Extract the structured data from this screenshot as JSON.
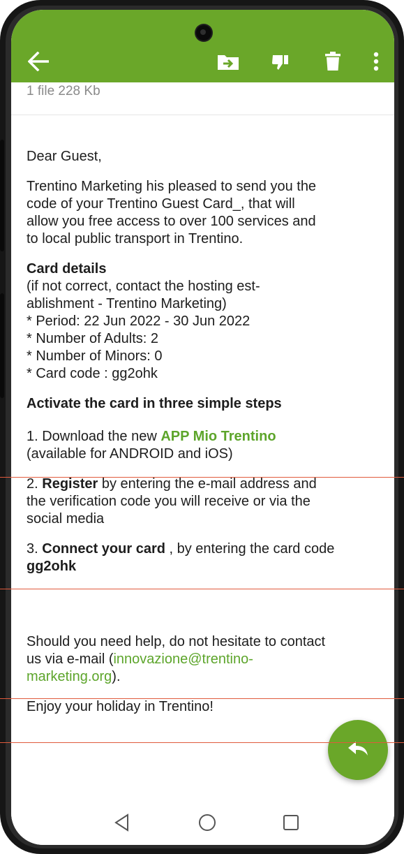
{
  "colors": {
    "accent": "#6aa729",
    "link": "#5da52b",
    "annotation_line": "#e05a3c"
  },
  "toolbar": {
    "icons": [
      "back-arrow-icon",
      "move-to-folder-icon",
      "thumbs-down-icon",
      "delete-icon",
      "more-vert-icon"
    ]
  },
  "attachment": {
    "summary": "1 file 228 Kb"
  },
  "email": {
    "greeting": "Dear Guest,",
    "intro": [
      "Trentino Marketing his pleased to send you the",
      "code of your Trentino Guest Card_, that will",
      "allow you free access to over 100 services and",
      "to local public transport in Trentino."
    ],
    "card_details_title": "Card details",
    "card_details_lines": [
      "(if not correct, contact the hosting est-",
      "ablishment - Trentino Marketing)",
      "* Period: 22 Jun 2022 - 30 Jun 2022",
      "* Number of Adults: 2",
      "* Number of Minors: 0",
      "* Card code : gg2ohk"
    ],
    "steps_title": "Activate the card in three simple steps",
    "step1": {
      "prefix": "1. Download the new ",
      "link": "APP Mio Trentino",
      "line2": "(available for ANDROID and iOS)"
    },
    "step2": {
      "prefix": "2. ",
      "bold": "Register",
      "suffix": " by entering the e-mail address and",
      "line2": "the verification code you will receive or via the",
      "line3": "social media"
    },
    "step3": {
      "prefix": "3. ",
      "bold": "Connect your card",
      "suffix": " , by entering the card code",
      "code": "gg2ohk"
    },
    "help": {
      "line1": "Should you need help, do not hesitate to contact",
      "line2_prefix": "us via e-mail (",
      "email_part1": "innovazione@trentino-",
      "email_part2": "marketing.org",
      "line3_suffix": ")."
    },
    "closing": "Enjoy your holiday in Trentino!"
  },
  "fab": {
    "icon": "reply-icon"
  },
  "system_nav": {
    "icons": [
      "back-triangle-icon",
      "home-circle-icon",
      "recents-square-icon"
    ]
  }
}
